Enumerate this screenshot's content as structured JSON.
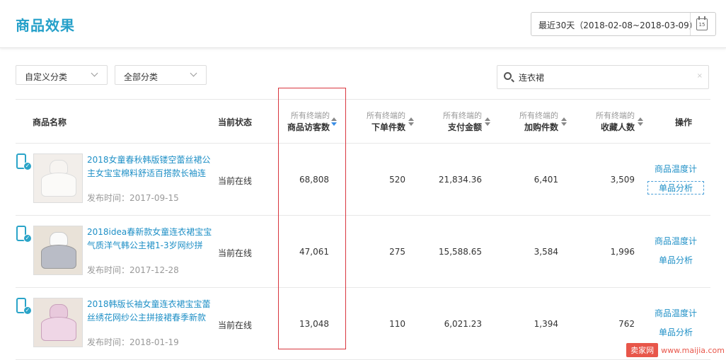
{
  "header": {
    "title": "商品效果",
    "date_range": "最近30天（2018-02-08~2018-03-09）",
    "calendar_day": "15"
  },
  "filters": {
    "custom_category": "自定义分类",
    "all_category": "全部分类",
    "search_value": "连衣裙",
    "clear_glyph": "×"
  },
  "table": {
    "col_name": "商品名称",
    "col_status": "当前状态",
    "col_ops": "操作",
    "metrics": [
      {
        "sub": "所有终端的",
        "main": "商品访客数",
        "active": true
      },
      {
        "sub": "所有终端的",
        "main": "下单件数",
        "active": false
      },
      {
        "sub": "所有终端的",
        "main": "支付金额",
        "active": false
      },
      {
        "sub": "所有终端的",
        "main": "加购件数",
        "active": false
      },
      {
        "sub": "所有终端的",
        "main": "收藏人数",
        "active": false
      }
    ],
    "rows": [
      {
        "title": "2018女童春秋韩版镂空蕾丝裙公主女宝宝棉料舒适百搭款长袖连",
        "date": "发布时间：2017-09-15",
        "status": "当前在线",
        "visitors": "68,808",
        "orders": "520",
        "payment": "21,834.36",
        "carts": "6,401",
        "favorites": "3,509",
        "op1": "商品温度计",
        "op2": "单品分析"
      },
      {
        "title": "2018idea春新款女童连衣裙宝宝气质洋气韩公主裙1-3岁网纱拼",
        "date": "发布时间：2017-12-28",
        "status": "当前在线",
        "visitors": "47,061",
        "orders": "275",
        "payment": "15,588.65",
        "carts": "3,584",
        "favorites": "1,996",
        "op1": "商品温度计",
        "op2": "单品分析"
      },
      {
        "title": "2018韩版长袖女童连衣裙宝宝蕾丝绣花网纱公主拼接裙春季新款",
        "date": "发布时间：2018-01-19",
        "status": "当前在线",
        "visitors": "13,048",
        "orders": "110",
        "payment": "6,021.23",
        "carts": "1,394",
        "favorites": "762",
        "op1": "商品温度计",
        "op2": "单品分析"
      }
    ]
  },
  "watermark": {
    "logo": "卖家网",
    "url": "www.maijia.com"
  },
  "colors": {
    "accent": "#25a0c9",
    "link": "#1e8fc6",
    "highlight_border": "#d9363e"
  }
}
